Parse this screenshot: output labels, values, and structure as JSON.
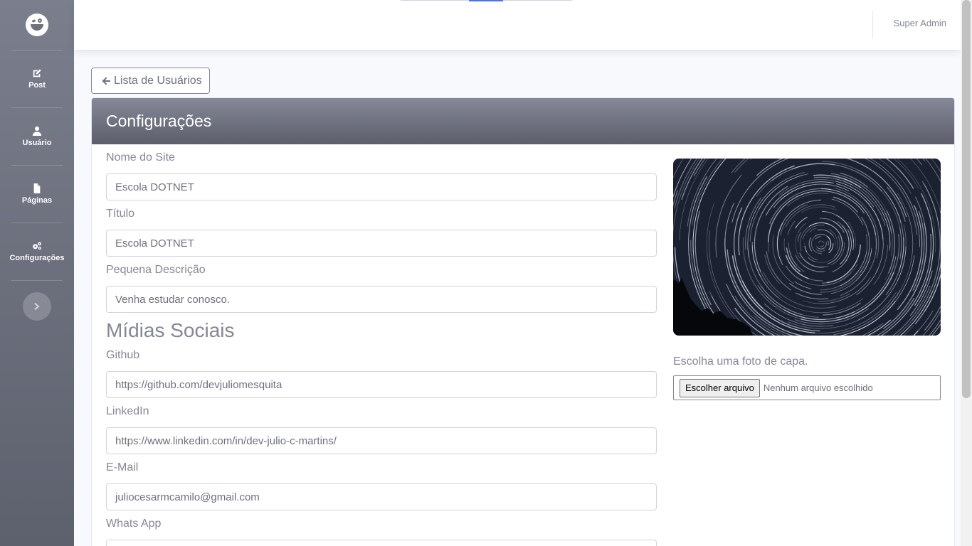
{
  "sidebar": {
    "brand_icon": "laughing-face-icon",
    "items": [
      {
        "label": "Post",
        "icon": "edit-icon"
      },
      {
        "label": "Usuário",
        "icon": "user-icon"
      },
      {
        "label": "Páginas",
        "icon": "file-icon"
      },
      {
        "label": "Configurações",
        "icon": "cogs-icon"
      }
    ],
    "toggle_icon": "chevron-right-icon"
  },
  "topbar": {
    "user_name": "Super Admin"
  },
  "back_button": {
    "label": "Lista de Usuários",
    "icon": "arrow-left-icon"
  },
  "card": {
    "title": "Configurações"
  },
  "form": {
    "site_name": {
      "label": "Nome do Site",
      "value": "Escola DOTNET"
    },
    "title": {
      "label": "Título",
      "value": "Escola DOTNET"
    },
    "description": {
      "label": "Pequena Descrição",
      "value": "Venha estudar conosco."
    },
    "social_heading": "Mídias Sociais",
    "github": {
      "label": "Github",
      "value": "https://github.com/devjuliomesquita"
    },
    "linkedin": {
      "label": "LinkedIn",
      "value": "https://www.linkedin.com/in/dev-julio-c-martins/"
    },
    "email": {
      "label": "E-Mail",
      "value": "juliocesarmcamilo@gmail.com"
    },
    "whatsapp": {
      "label": "Whats App",
      "value": ""
    }
  },
  "cover": {
    "label": "Escolha uma foto de capa.",
    "file_button": "Escolher arquivo",
    "file_status": "Nenhum arquivo escolhido"
  },
  "colors": {
    "sidebar_top": "#7b7e8c",
    "sidebar_bottom": "#5d606d",
    "header_gradient_top": "#858896",
    "header_gradient_bottom": "#5c5e6c"
  }
}
